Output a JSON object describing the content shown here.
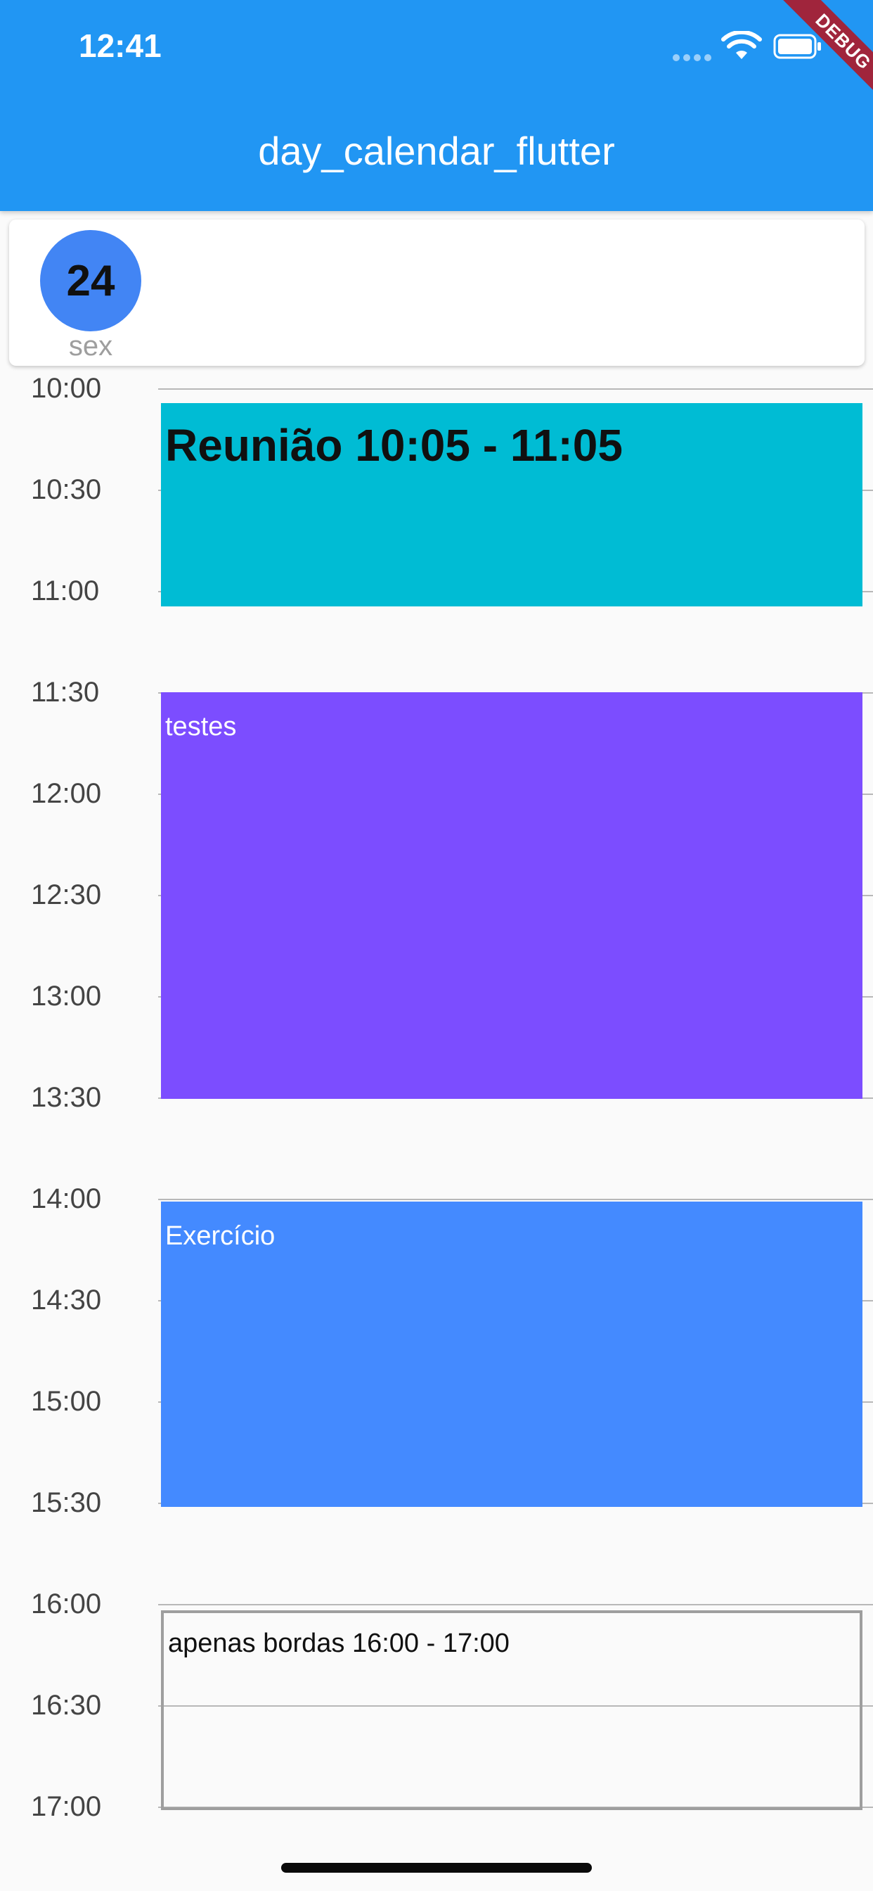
{
  "status_bar": {
    "time": "12:41"
  },
  "debug_banner": "DEBUG",
  "app_bar": {
    "title": "day_calendar_flutter"
  },
  "day_header": {
    "day_number": "24",
    "weekday": "sex"
  },
  "timeline": {
    "hours": [
      "10:00",
      "10:30",
      "11:00",
      "11:30",
      "12:00",
      "12:30",
      "13:00",
      "13:30",
      "14:00",
      "14:30",
      "15:00",
      "15:30",
      "16:00",
      "16:30",
      "17:00"
    ]
  },
  "events": [
    {
      "title": "Reunião 10:05 - 11:05",
      "color": "#00bcd4"
    },
    {
      "title": "testes",
      "color": "#7c4dff"
    },
    {
      "title": "Exercício",
      "color": "#448aff"
    },
    {
      "title": "apenas bordas 16:00 - 17:00",
      "color": "#9e9e9e"
    }
  ],
  "colors": {
    "app_bar": "#2196f3",
    "day_circle": "#4285f4",
    "debug": "#a0253c"
  }
}
